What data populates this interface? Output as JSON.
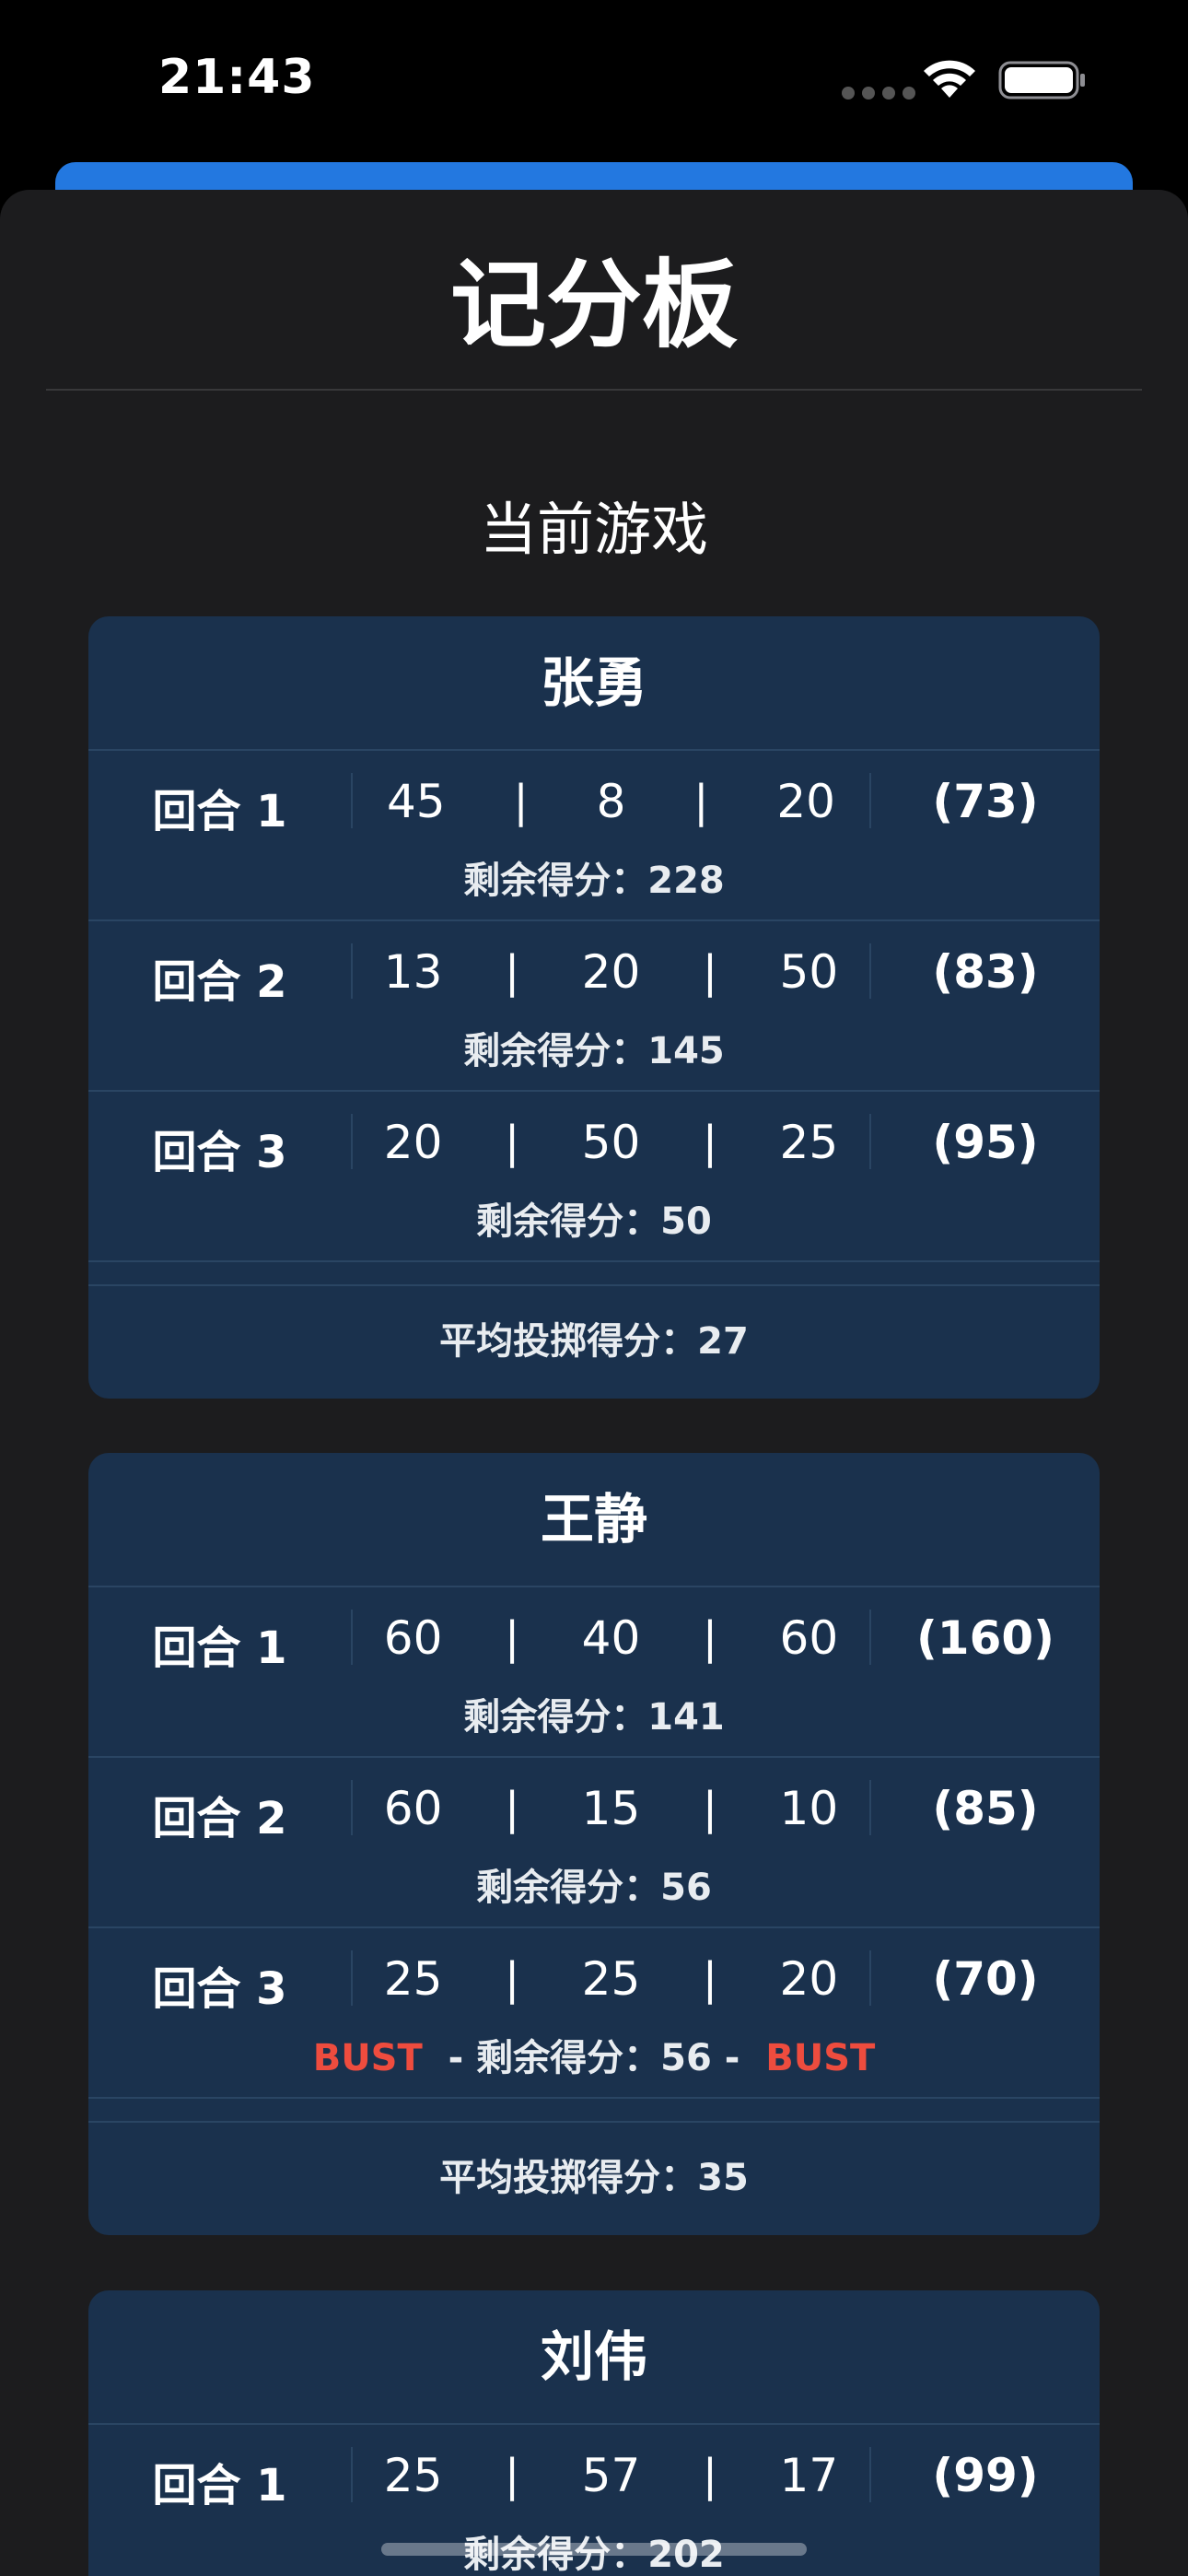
{
  "status": {
    "time": "21:43"
  },
  "header": {
    "title": "记分板",
    "section": "当前游戏"
  },
  "players": [
    {
      "name": "张勇",
      "rounds": [
        {
          "label": "回合 1",
          "throws": [
            "45",
            "8",
            "20"
          ],
          "total": "(73)",
          "remaining_label": "剩余得分：",
          "remaining": "228",
          "bust": false
        },
        {
          "label": "回合 2",
          "throws": [
            "13",
            "20",
            "50"
          ],
          "total": "(83)",
          "remaining_label": "剩余得分：",
          "remaining": "145",
          "bust": false
        },
        {
          "label": "回合 3",
          "throws": [
            "20",
            "50",
            "25"
          ],
          "total": "(95)",
          "remaining_label": "剩余得分：",
          "remaining": "50",
          "bust": false
        }
      ],
      "avg_label": "平均投掷得分：",
      "avg": "27"
    },
    {
      "name": "王静",
      "rounds": [
        {
          "label": "回合 1",
          "throws": [
            "60",
            "40",
            "60"
          ],
          "total": "(160)",
          "remaining_label": "剩余得分：",
          "remaining": "141",
          "bust": false
        },
        {
          "label": "回合 2",
          "throws": [
            "60",
            "15",
            "10"
          ],
          "total": "(85)",
          "remaining_label": "剩余得分：",
          "remaining": "56",
          "bust": false
        },
        {
          "label": "回合 3",
          "throws": [
            "25",
            "25",
            "20"
          ],
          "total": "(70)",
          "remaining_label": "剩余得分：",
          "remaining": "56",
          "bust": true,
          "bust_text": "BUST"
        }
      ],
      "avg_label": "平均投掷得分：",
      "avg": "35"
    },
    {
      "name": "刘伟",
      "rounds": [
        {
          "label": "回合 1",
          "throws": [
            "25",
            "57",
            "17"
          ],
          "total": "(99)",
          "remaining_label": "剩余得分：",
          "remaining": "202",
          "bust": false
        }
      ]
    }
  ],
  "colors": {
    "card": "#1a314d",
    "sheet": "#1c1c1e",
    "accent": "#2378e0",
    "bust": "#ee4c3e"
  }
}
